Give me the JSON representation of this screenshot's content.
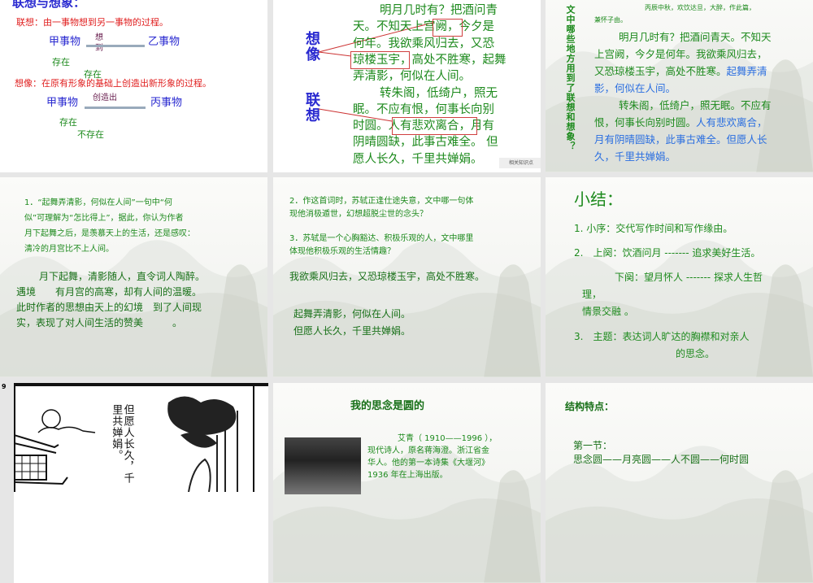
{
  "slide1": {
    "title": "联想与想象：",
    "assoc_def": "联想：由一事物想到另一事物的过程。",
    "a_from": "甲事物",
    "a_arrow": "想到",
    "a_to": "乙事物",
    "a_exist1": "存在",
    "a_exist2": "存在",
    "imag_def": "想像：在原有形象的基础上创造出新形象的过程。",
    "i_from": "甲事物",
    "i_arrow": "创造出",
    "i_to": "丙事物",
    "i_exist": "存在",
    "i_notexist": "不存在"
  },
  "slide2": {
    "label_imagine": "想像",
    "label_assoc": "联想",
    "lines": [
      "明月几时有？把酒问青",
      "天。不知天上宫阙，今夕是",
      "何年。我欲乘风归去，又恐",
      "琼楼玉宇，高处不胜寒，起舞",
      "弄清影，何似在人间。",
      "转朱阁，低绮户，照无",
      "眠。不应有恨，何事长向别",
      "时圆。人有悲欢离合，月有",
      "阴晴圆缺，此事古难全。 但",
      "愿人长久，千里共婵娟。"
    ],
    "badge": "相关知识点"
  },
  "slide3": {
    "side_question": "文中哪些地方用到了联想和想象？",
    "preface1": "丙辰中秋，欢饮达旦，大醉，作此篇，",
    "preface2": "兼怀子由。",
    "p1a": "明月几时有？把酒问青天。不知天",
    "p1b": "上宫阙，今夕是何年。我欲乘风归去，",
    "p1c": "又恐琼楼玉宇，高处不胜寒。",
    "p1d": "起舞弄清",
    "p1e": "影，何似在人间。",
    "p2a": "转朱阁，低绮户，照无眠。不应有",
    "p2b": "恨，何事长向别时圆。",
    "p2c": "人有悲欢离合，",
    "p2d": "月有阴晴圆缺，此事古难全。但愿人长",
    "p2e": "久，千里共婵娟。"
  },
  "slide4": {
    "q": [
      "1．“起舞弄清影，何似在人间”一句中“何",
      "似”可理解为“怎比得上”，据此，你认为作者",
      "月下起舞之后，是羡慕天上的生活，还是感叹：",
      "清冷的月宫比不上人间。"
    ],
    "a": [
      "月下起舞，清影随人，直令词人陶醉。",
      "遇境　　有月宫的高寒，却有人间的温暖。",
      "此时作者的思想由天上的幻境　到了人间现",
      "实，表现了对人间生活的赞美　　　。"
    ]
  },
  "slide5": {
    "q2": [
      "2．作这首词时，苏轼正逢仕途失意，文中哪一句体",
      "现他消极遁世，幻想超脱尘世的念头？"
    ],
    "q3": [
      "3．苏轼是一个心胸豁达、积极乐观的人，文中哪里",
      "体现他积极乐观的生活情趣？"
    ],
    "a2": "我欲乘风归去，又恐琼楼玉宇，高处不胜寒。",
    "a3": [
      "起舞弄清影，何似在人间。",
      "但愿人长久，千里共婵娟。"
    ]
  },
  "slide6": {
    "title": "小结：",
    "items": [
      "1. 小序：交代写作时间和写作缘由。",
      "2.　上阕：饮酒问月 ------- 追求美好生活。",
      "下阕：望月怀人 ------- 探求人生哲",
      "理，",
      "情景交融 。",
      "3.　主题：表达词人旷达的胸襟和对亲人",
      "的思念。"
    ]
  },
  "slide7": {
    "number": "9",
    "poem": "但愿人长久，千里共婵娟。"
  },
  "slide8": {
    "title": "我的思念是圆的",
    "bio": [
      "艾青（ 1910——1996 ），",
      "现代诗人，原名蒋海澄。浙江省金",
      "华人。他的第一本诗集《大堰河》",
      "1936 年在上海出版。"
    ]
  },
  "slide9": {
    "title": "结构特点：",
    "sub": "第一节：",
    "line": "思念圆——月亮圆——人不圆——何时圆"
  }
}
